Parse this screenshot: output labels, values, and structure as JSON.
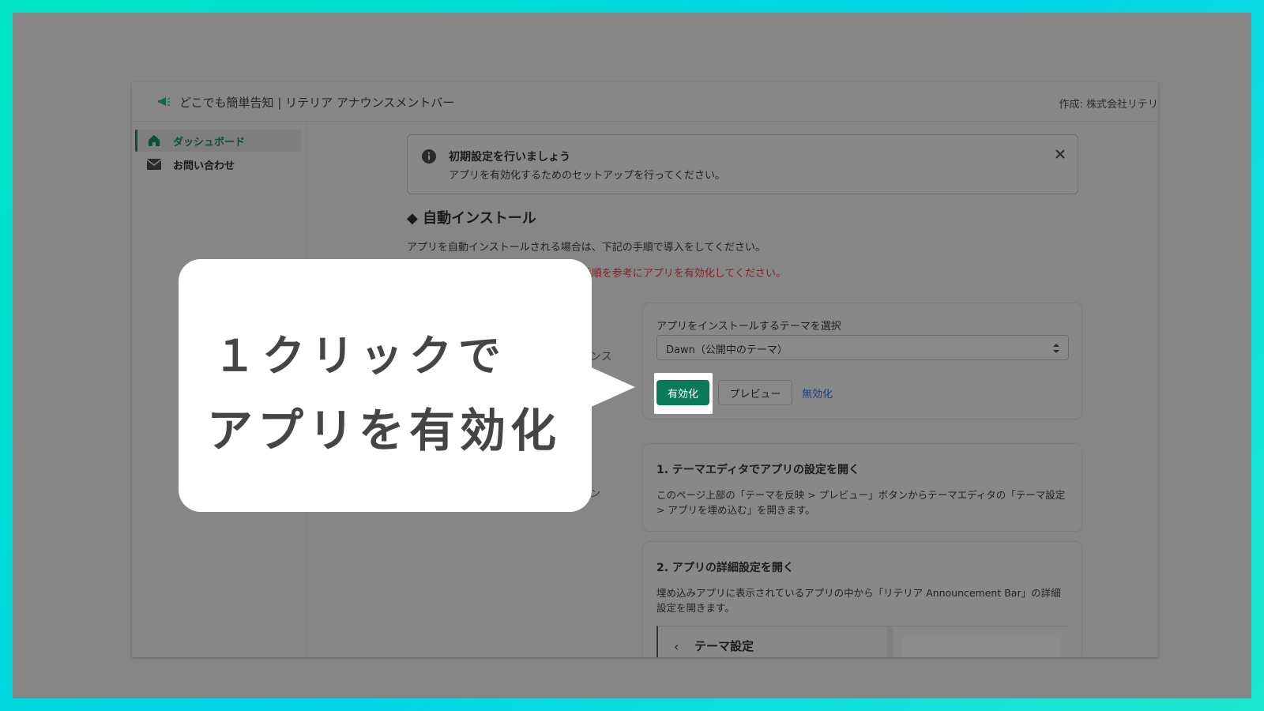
{
  "app": {
    "title": "どこでも簡単告知 | リテリア アナウンスメントバー",
    "credit": "作成: 株式会社リテリ"
  },
  "sidebar": {
    "items": [
      {
        "label": "ダッシュボード",
        "icon": "home-icon",
        "active": true
      },
      {
        "label": "お問い合わせ",
        "icon": "mail-icon",
        "active": false
      }
    ]
  },
  "banner": {
    "title": "初期設定を行いましょう",
    "text": "アプリを有効化するためのセットアップを行ってください。"
  },
  "section": {
    "title": "◆ 自動インストール",
    "description": "アプリを自動インストールされる場合は、下記の手順で導入をしてください。",
    "warning": "は、お手数ですが手動インストールの手順を参考にアプリを有効化してください。",
    "fragment_install": "ンス",
    "fragment_step": "ン"
  },
  "theme_card": {
    "select_label": "アプリをインストールするテーマを選択",
    "selected_theme": "Dawn（公開中のテーマ）",
    "enable_label": "有効化",
    "preview_label": "プレビュー",
    "disable_label": "無効化"
  },
  "step1": {
    "title": "1. テーマエディタでアプリの設定を開く",
    "text": "このページ上部の「テーマを反映 > プレビュー」ボタンからテーマエディタの「テーマ設定 > アプリを埋め込む」を開きます。"
  },
  "step2": {
    "title": "2. アプリの詳細設定を開く",
    "text": "埋め込みアプリに表示されているアプリの中から「リテリア Announcement Bar」の詳細設定を開きます。",
    "panel_title": "テーマ設定"
  },
  "callout": {
    "line1": "１クリックで",
    "line2": "アプリを有効化"
  },
  "colors": {
    "brand_green": "#0a7a5a",
    "warning_red": "#8a1f1f",
    "link_blue": "#1f3f75",
    "frame_gradient": "#00e5c4"
  }
}
